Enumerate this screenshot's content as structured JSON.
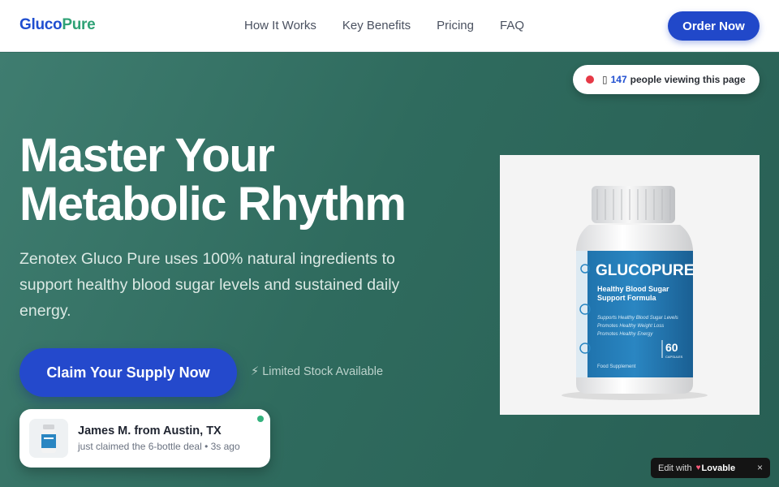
{
  "brand": {
    "part1": "Gluco",
    "part2": "Pure",
    "color1": "#1f4ed0",
    "color2": "#2fa276"
  },
  "nav": {
    "links": [
      "How It Works",
      "Key Benefits",
      "Pricing",
      "FAQ"
    ],
    "cta": "Order Now"
  },
  "viewers": {
    "glyph": "▯",
    "count": "147",
    "text": "people viewing this page"
  },
  "hero": {
    "headline_line1": "Master Your",
    "headline_line2": "Metabolic Rhythm",
    "subtext": "Zenotex Gluco Pure uses 100% natural ingredients to support healthy blood sugar levels and sustained daily energy.",
    "cta": "Claim Your Supply Now",
    "stock_note": "⚡ Limited Stock Available"
  },
  "product": {
    "label_brand": "GLUCOPURE",
    "label_line1": "Healthy Blood Sugar",
    "label_line2": "Support Formula",
    "benefit1": "Supports Healthy Blood Sugar Levels",
    "benefit2": "Promotes Healthy Weight Loss",
    "benefit3": "Promotes Healthy Energy",
    "count": "60",
    "count_unit": "CAPSULES",
    "footer": "Food Supplement"
  },
  "toast": {
    "name": "James M. from Austin, TX",
    "detail": "just claimed the 6-bottle deal • 3s ago"
  },
  "lovable": {
    "prefix": "Edit with",
    "brand": "Lovable",
    "close": "×"
  },
  "colors": {
    "accent": "#2449cc",
    "hero_bg": "#2f6b5e",
    "live_dot": "#e63946",
    "online_dot": "#34b27d"
  }
}
